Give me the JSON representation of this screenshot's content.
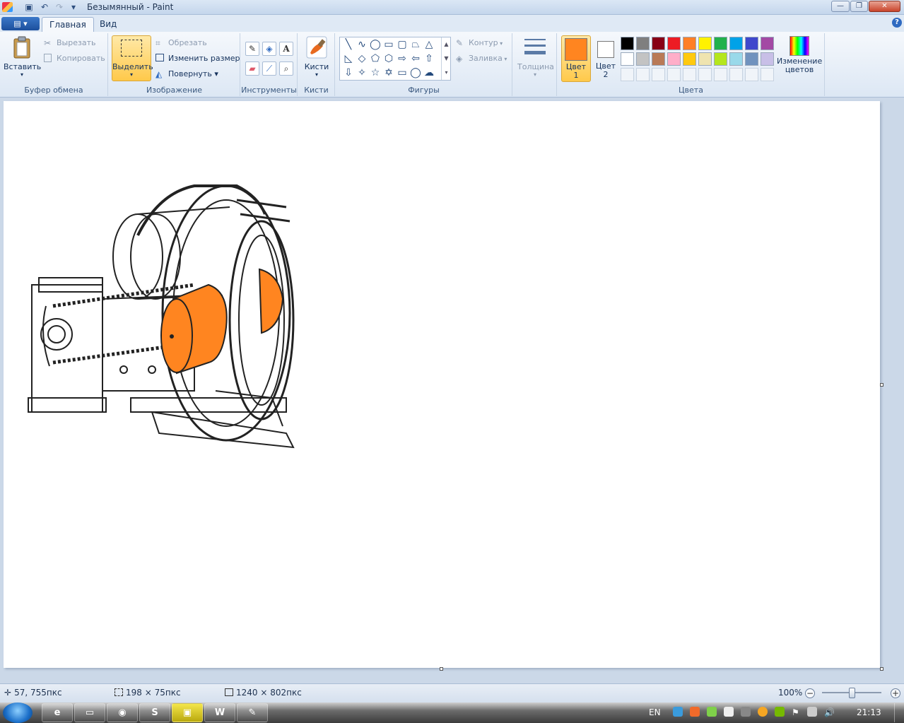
{
  "window": {
    "title": "Безымянный - Paint",
    "minimize": "—",
    "maximize": "❐",
    "close": "✕"
  },
  "qat": {
    "save_icon": "save-icon",
    "undo_icon": "undo-icon",
    "redo_icon": "redo-icon",
    "customize_icon": "chevron-down-icon"
  },
  "tabs": {
    "file": "▤ ▾",
    "items": [
      {
        "label": "Главная",
        "active": true
      },
      {
        "label": "Вид",
        "active": false
      }
    ],
    "help": "?"
  },
  "clipboard": {
    "paste": "Вставить",
    "cut": "Вырезать",
    "copy": "Копировать",
    "label": "Буфер обмена"
  },
  "image": {
    "select": "Выделить",
    "crop": "Обрезать",
    "resize": "Изменить размер",
    "rotate": "Повернуть ▾",
    "label": "Изображение"
  },
  "tools": {
    "label": "Инструменты"
  },
  "brushes": {
    "label": "Кисти"
  },
  "shapes": {
    "outline": "Контур",
    "fill": "Заливка",
    "label": "Фигуры"
  },
  "size": {
    "label": "Толщина"
  },
  "colors": {
    "color1": "Цвет 1",
    "color2": "Цвет 2",
    "edit": "Изменение цветов",
    "label": "Цвета",
    "color1_value": "#ff8520",
    "color2_value": "#ffffff",
    "palette_row1": [
      "#000000",
      "#7f7f7f",
      "#880015",
      "#ed1c24",
      "#ff7f27",
      "#fff200",
      "#22b14c",
      "#00a2e8",
      "#3f48cc",
      "#a349a4"
    ],
    "palette_row2": [
      "#ffffff",
      "#c3c3c3",
      "#b97a57",
      "#ffaec9",
      "#ffc90e",
      "#efe4b0",
      "#b5e61d",
      "#99d9ea",
      "#7092be",
      "#c8bfe7"
    ]
  },
  "status": {
    "cursor": "57, 755пкс",
    "selection": "198 × 75пкс",
    "canvas_size": "1240 × 802пкс",
    "zoom": "100%",
    "zoom_level": 0.5
  },
  "taskbar": {
    "lang": "EN",
    "clock": "21:13",
    "apps": [
      "e",
      "▭",
      "◉",
      "S",
      "▣",
      "W",
      "✎"
    ]
  }
}
